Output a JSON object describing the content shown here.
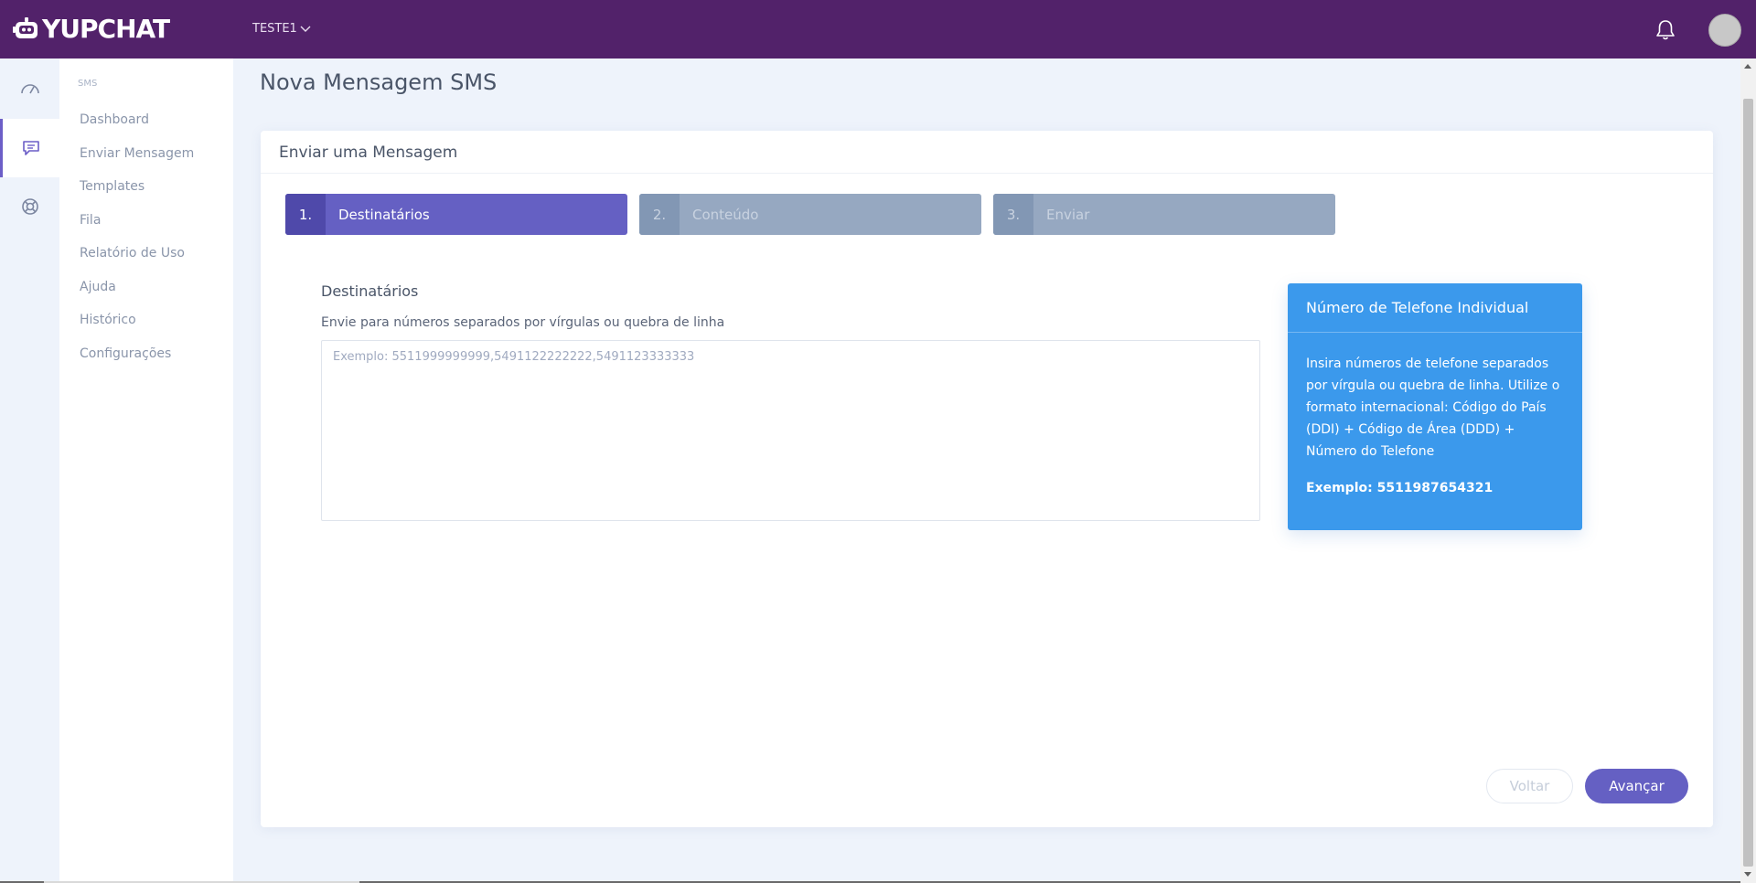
{
  "header": {
    "logo_text": "YUPCHAT",
    "workspace": "TESTE1",
    "colors": {
      "topbar": "#52226a",
      "accent": "#6560c3"
    }
  },
  "rail": {
    "items": [
      {
        "icon": "gauge-icon"
      },
      {
        "icon": "message-icon"
      },
      {
        "icon": "lifebuoy-icon"
      }
    ]
  },
  "sidebar": {
    "section": "SMS",
    "items": [
      {
        "label": "Dashboard"
      },
      {
        "label": "Enviar Mensagem"
      },
      {
        "label": "Templates"
      },
      {
        "label": "Fila"
      },
      {
        "label": "Relatório de Uso"
      },
      {
        "label": "Ajuda"
      },
      {
        "label": "Histórico"
      },
      {
        "label": "Configurações"
      }
    ]
  },
  "main": {
    "page_title": "Nova Mensagem SMS",
    "card_title": "Enviar uma Mensagem",
    "steps": [
      {
        "num": "1.",
        "label": "Destinatários",
        "state": "active"
      },
      {
        "num": "2.",
        "label": "Conteúdo",
        "state": "inactive"
      },
      {
        "num": "3.",
        "label": "Enviar",
        "state": "inactive"
      }
    ],
    "recipients": {
      "title": "Destinatários",
      "help": "Envie para números separados por vírgulas ou quebra de linha",
      "placeholder": "Exemplo: 5511999999999,5491122222222,5491123333333",
      "value": ""
    },
    "info": {
      "title": "Número de Telefone Individual",
      "body": "Insira números de telefone separados por vírgula ou quebra de linha. Utilize o formato internacional: Código do País (DDI) + Código de Área (DDD) + Número do Telefone",
      "example": "Exemplo: 5511987654321"
    },
    "buttons": {
      "back": "Voltar",
      "next": "Avançar"
    }
  }
}
